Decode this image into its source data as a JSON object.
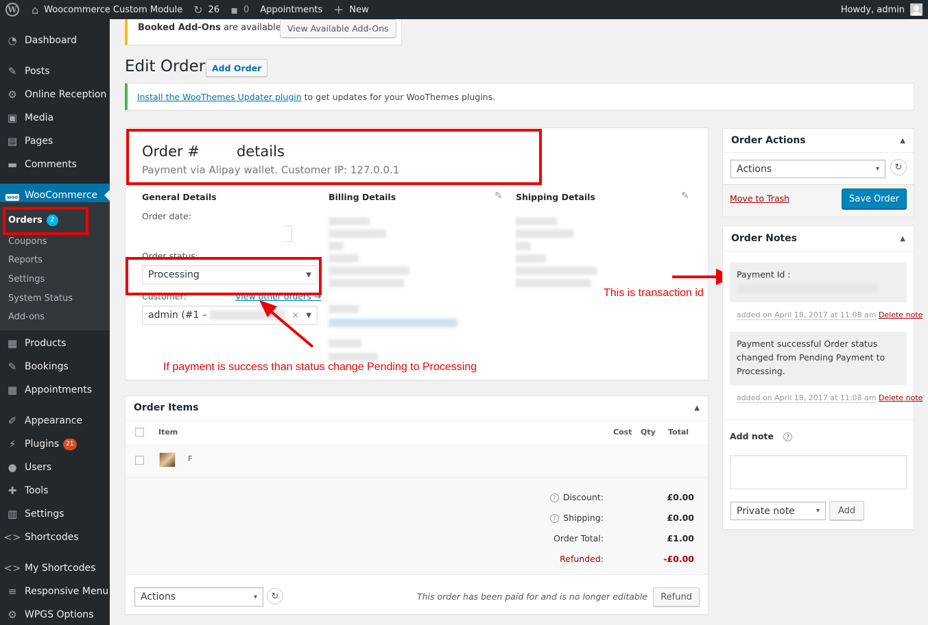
{
  "adminbar": {
    "site_name": "Woocommerce Custom Module",
    "updates_count": "26",
    "comments_count": "0",
    "appointments": "Appointments",
    "new": "New",
    "howdy": "Howdy, admin"
  },
  "sidebar": {
    "items": [
      {
        "label": "Dashboard",
        "icon": "dashboard-icon"
      },
      {
        "label": "Posts",
        "icon": "pin-icon"
      },
      {
        "label": "Online Reception",
        "icon": "gear-icon"
      },
      {
        "label": "Media",
        "icon": "media-icon"
      },
      {
        "label": "Pages",
        "icon": "pages-icon"
      },
      {
        "label": "Comments",
        "icon": "comment-icon"
      },
      {
        "label": "WooCommerce",
        "icon": "woo-icon"
      },
      {
        "label": "Products",
        "icon": "archive-icon"
      },
      {
        "label": "Bookings",
        "icon": "pin-icon"
      },
      {
        "label": "Appointments",
        "icon": "calendar-icon"
      },
      {
        "label": "Appearance",
        "icon": "brush-icon"
      },
      {
        "label": "Plugins",
        "icon": "plugin-icon",
        "badge": "21"
      },
      {
        "label": "Users",
        "icon": "user-icon"
      },
      {
        "label": "Tools",
        "icon": "wrench-icon"
      },
      {
        "label": "Settings",
        "icon": "settings-icon"
      },
      {
        "label": "Shortcodes",
        "icon": "code-icon"
      },
      {
        "label": "My Shortcodes",
        "icon": "code-icon"
      },
      {
        "label": "Responsive Menu",
        "icon": "menu-icon"
      },
      {
        "label": "WPGS Options",
        "icon": "gear-icon"
      }
    ],
    "woo_submenu": [
      {
        "label": "Orders",
        "badge": "2"
      },
      {
        "label": "Coupons"
      },
      {
        "label": "Reports"
      },
      {
        "label": "Settings"
      },
      {
        "label": "System Status"
      },
      {
        "label": "Add-ons"
      }
    ]
  },
  "addons_notice": {
    "text_bold": "Booked Add-Ons",
    "text_rest": " are available!",
    "button": "View Available Add-Ons"
  },
  "page": {
    "title": "Edit Order",
    "add_button": "Add Order"
  },
  "updater_notice": {
    "link": "Install the WooThemes Updater plugin",
    "rest": " to get updates for your WooThemes plugins."
  },
  "order": {
    "heading_left": "Order #",
    "heading_right": "details",
    "payment_line": "Payment via Alipay wallet. Customer IP: 127.0.0.1",
    "general_title": "General Details",
    "billing_title": "Billing Details",
    "shipping_title": "Shipping Details",
    "order_date_label": "Order date:",
    "order_status_label": "Order status:",
    "status_value": "Processing",
    "customer_label": "Customer:",
    "view_other_orders": "View other orders →",
    "customer_value": "admin (#1 –"
  },
  "annotations": {
    "status_note": "If payment is success than status change Pending to Processing",
    "transaction_note": "This is transaction id"
  },
  "order_items": {
    "title": "Order Items",
    "columns": {
      "item": "Item",
      "cost": "Cost",
      "qty": "Qty",
      "total": "Total"
    },
    "first_item_initial": "F",
    "totals": [
      {
        "label": "Discount:",
        "value": "£0.00",
        "help": true
      },
      {
        "label": "Shipping:",
        "value": "£0.00",
        "help": true
      },
      {
        "label": "Order Total:",
        "value": "£1.00",
        "help": false
      },
      {
        "label": "Refunded:",
        "value": "-£0.00",
        "help": false,
        "color": "#a00"
      }
    ],
    "actions_select": "Actions",
    "paid_message": "This order has been paid for and is no longer editable",
    "refund_button": "Refund"
  },
  "order_actions": {
    "title": "Order Actions",
    "select_value": "Actions",
    "trash_link": "Move to Trash",
    "save_button": "Save Order"
  },
  "order_notes": {
    "title": "Order Notes",
    "notes": [
      {
        "text": "Payment Id :",
        "meta": "added on April 18, 2017 at 11:08 am",
        "delete": "Delete note"
      },
      {
        "text": "Payment successful Order status changed from Pending Payment to Processing.",
        "meta": "added on April 18, 2017 at 11:08 am",
        "delete": "Delete note"
      }
    ],
    "add_note_label": "Add note",
    "note_type": "Private note",
    "add_button": "Add"
  },
  "colors": {
    "admin_dark": "#23282d",
    "wp_blue": "#0073aa",
    "annotation_red": "#ee0000"
  }
}
